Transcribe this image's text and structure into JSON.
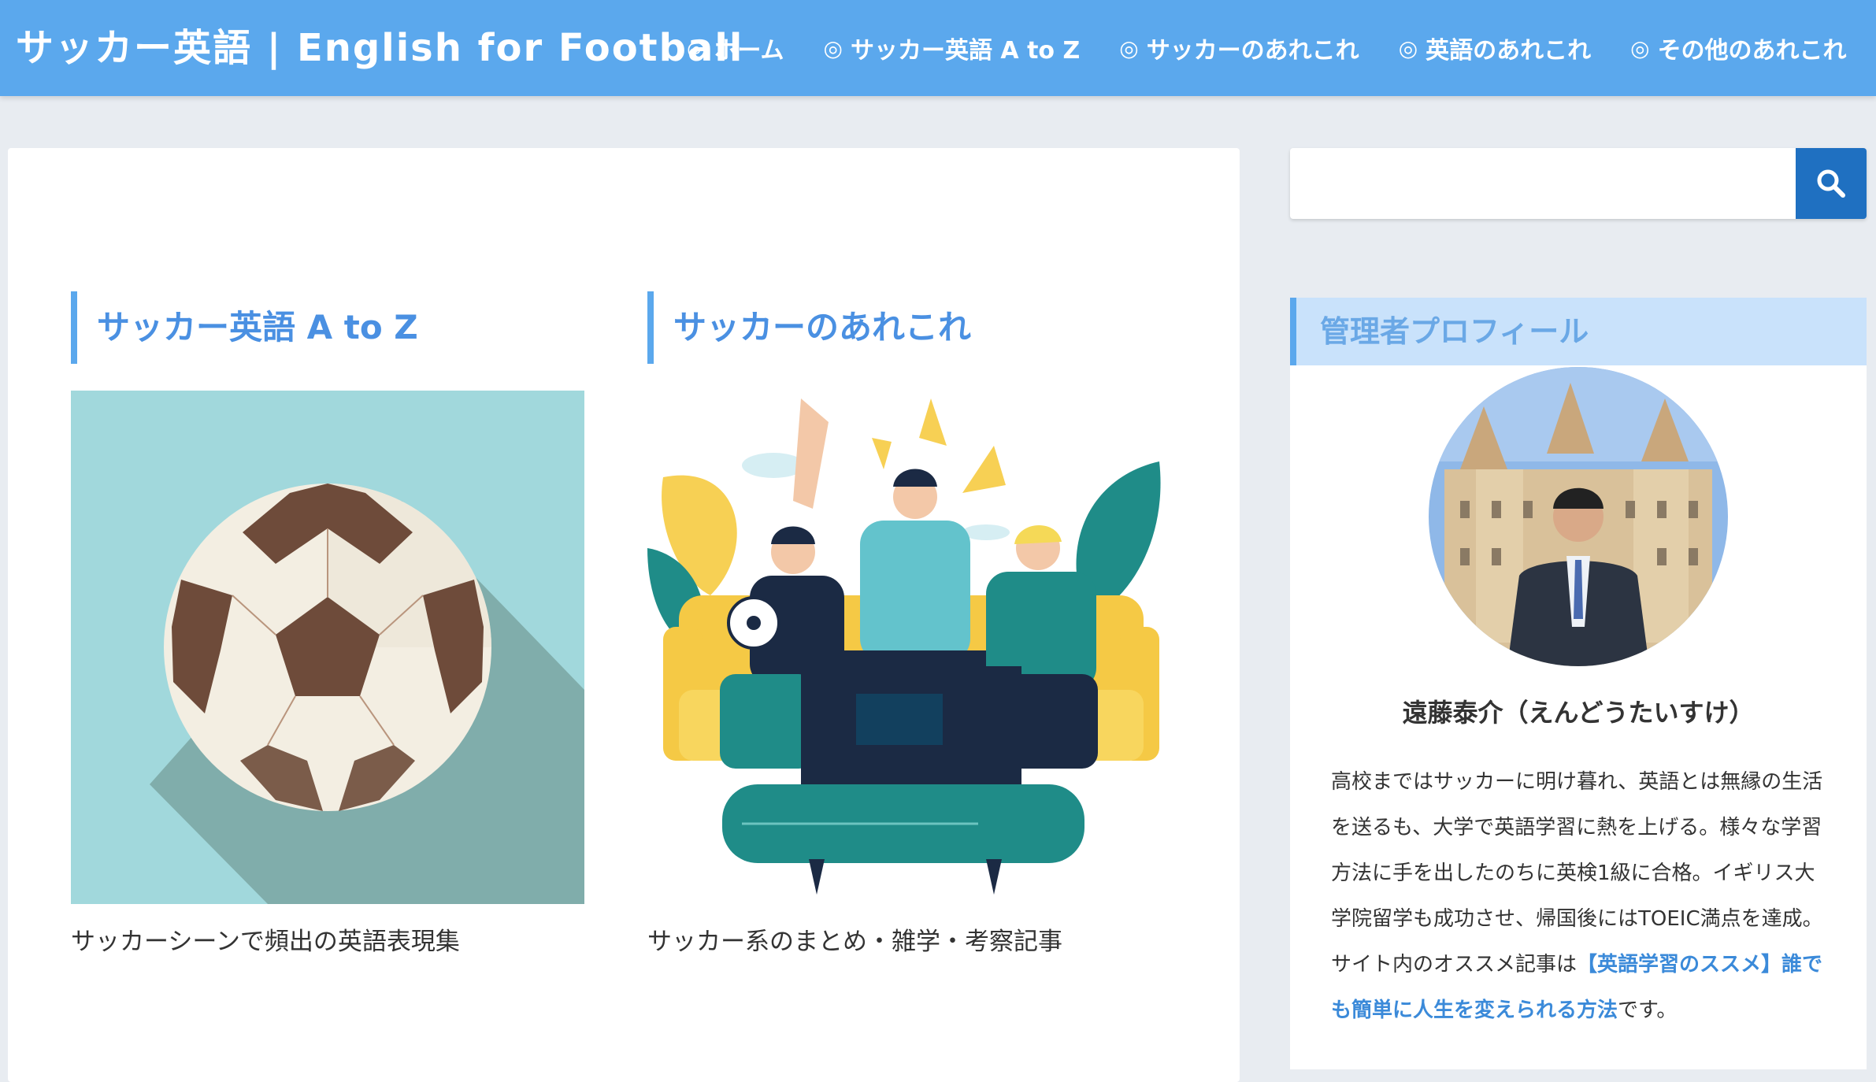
{
  "header": {
    "site_title": "サッカー英語 | English for Football",
    "nav": [
      {
        "icon": "◎",
        "label": "ホーム"
      },
      {
        "icon": "◎",
        "label": "サッカー英語 A to Z"
      },
      {
        "icon": "◎",
        "label": "サッカーのあれこれ"
      },
      {
        "icon": "◎",
        "label": "英語のあれこれ"
      },
      {
        "icon": "◎",
        "label": "その他のあれこれ"
      }
    ]
  },
  "categories": [
    {
      "title": "サッカー英語 A to Z",
      "description": "サッカーシーンで頻出の英語表現集",
      "image_icon": "soccer-ball-illustration"
    },
    {
      "title": "サッカーのあれこれ",
      "description": "サッカー系のまとめ・雑学・考察記事",
      "image_icon": "fans-watching-tv-illustration"
    }
  ],
  "search": {
    "placeholder": "",
    "button_icon": "search-icon"
  },
  "profile": {
    "title": "管理者プロフィール",
    "name": "遠藤泰介（えんどうたいすけ）",
    "bio_text": "高校まではサッカーに明け暮れ、英語とは無縁の生活を送るも、大学で英語学習に熱を上げる。様々な学習方法に手を出したのちに英検1級に合格。イギリス大学院留学も成功させ、帰国後にはTOEIC満点を達成。サイト内のオススメ記事は",
    "bio_link": "【英語学習のススメ】誰でも簡単に人生を変えられる方法",
    "bio_suffix": "です。"
  },
  "colors": {
    "header_bg": "#5ba8ed",
    "accent": "#4a90e2",
    "search_button": "#1f70c1",
    "profile_title_bg": "#c9e2fb"
  }
}
